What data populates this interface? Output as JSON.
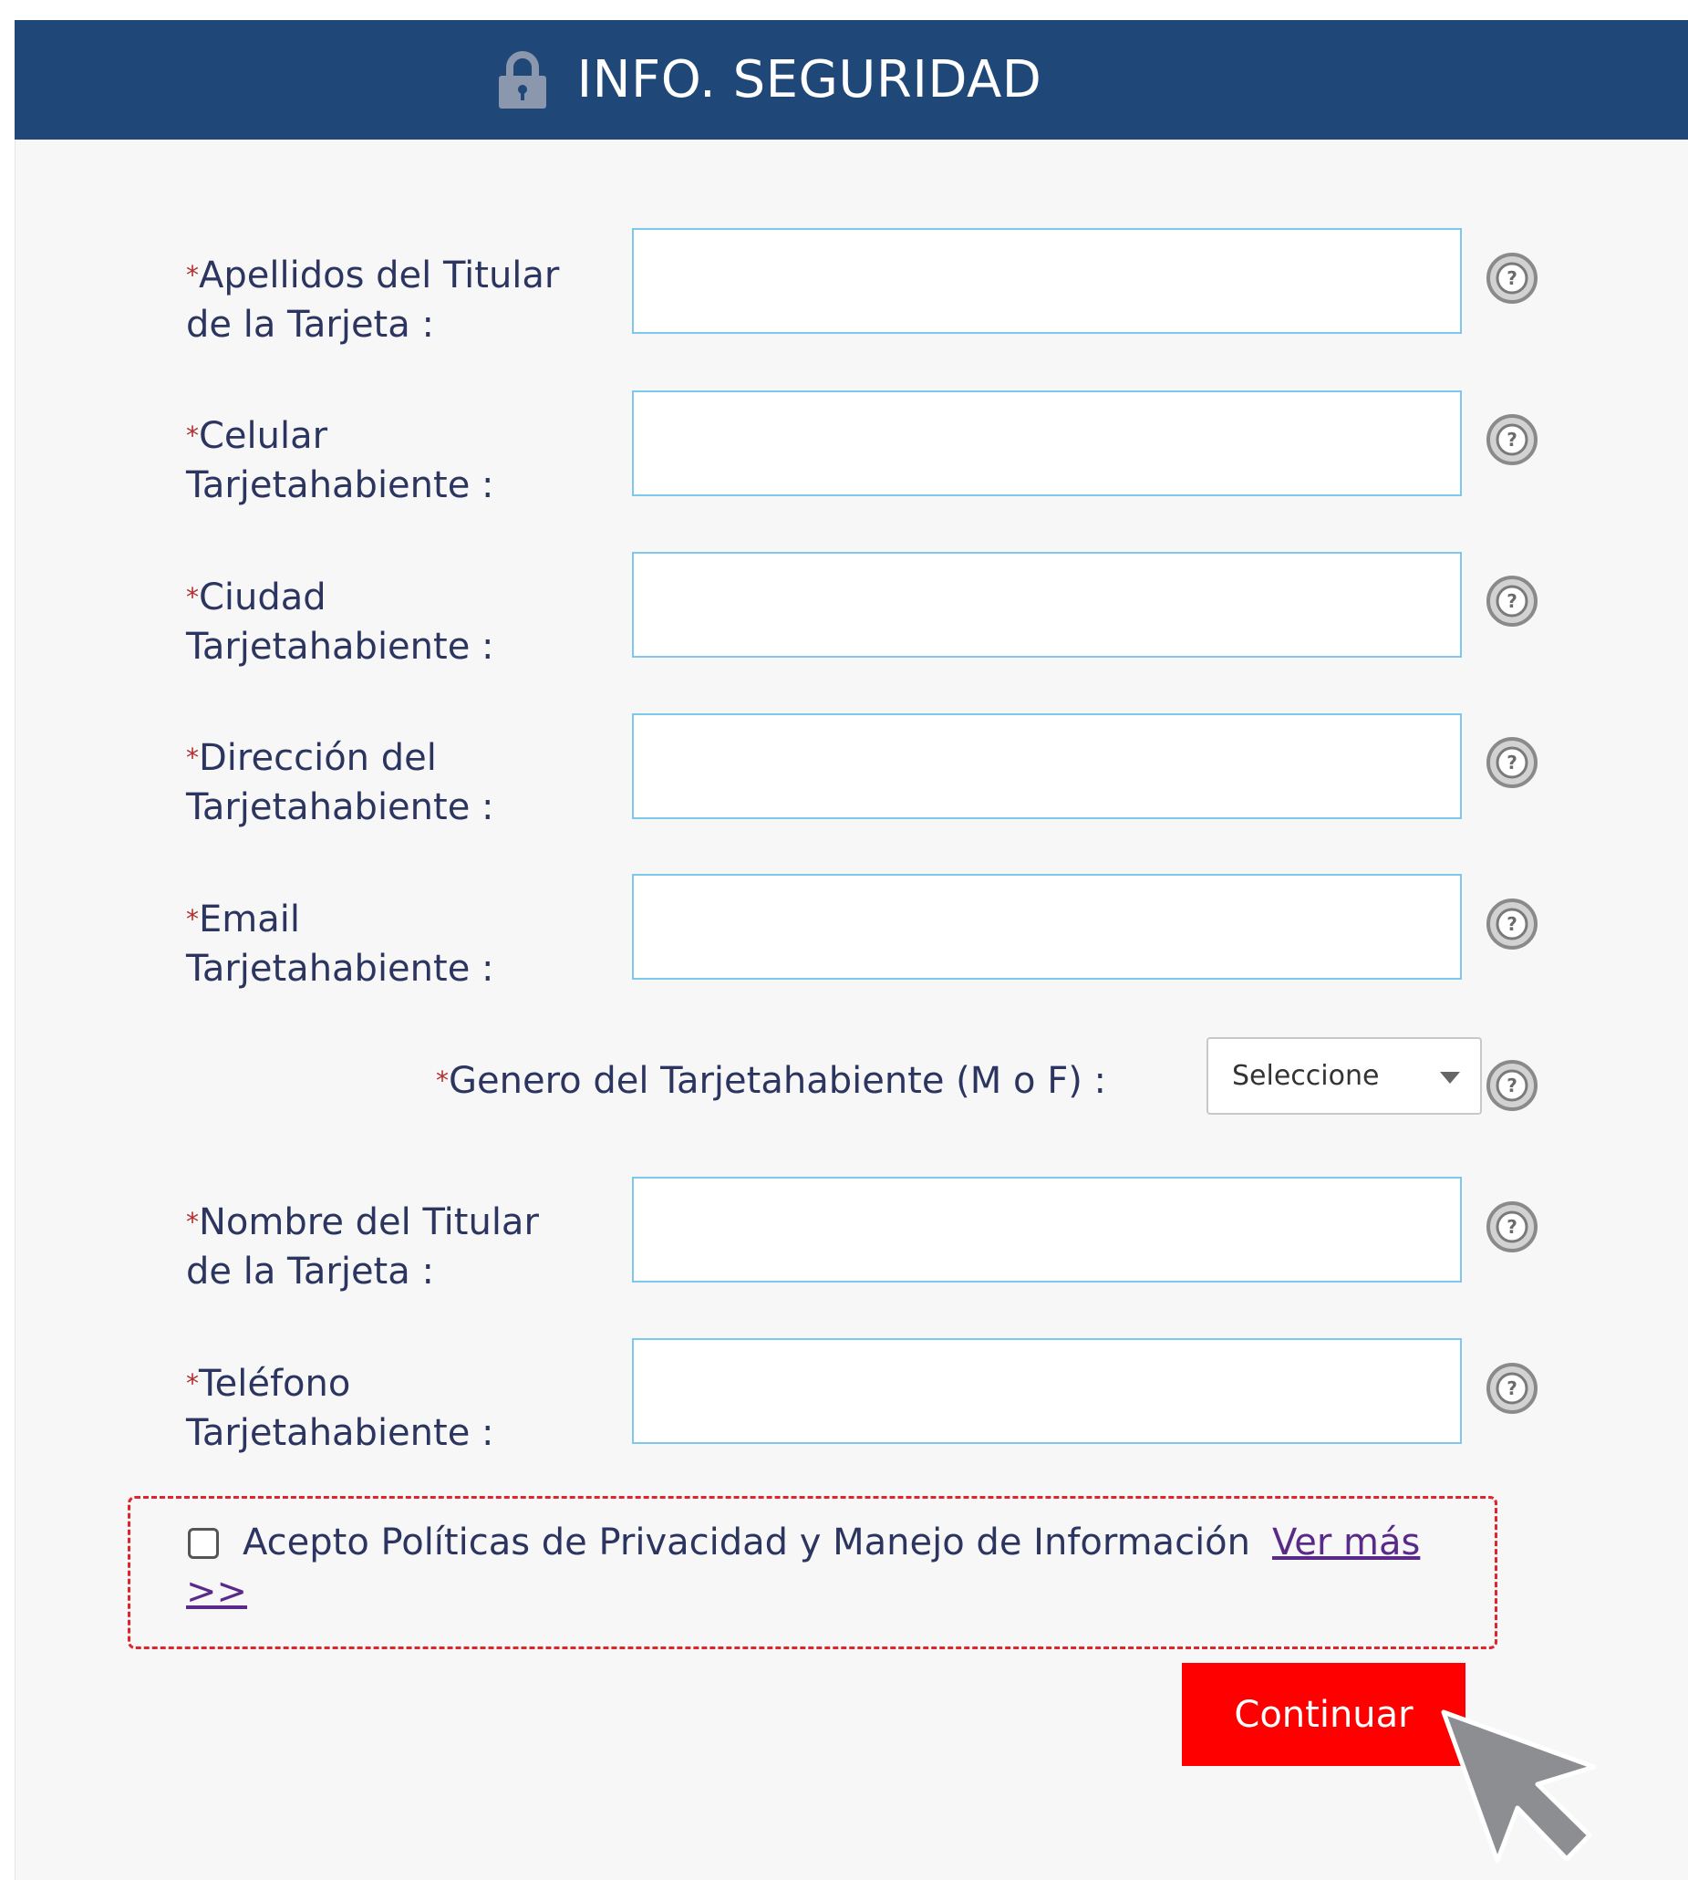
{
  "header": {
    "title": "INFO. SEGURIDAD",
    "icon": "lock-icon"
  },
  "form": {
    "required_marker": "*",
    "fields": [
      {
        "label_line1": "Apellidos del Titular",
        "label_line2": "de la Tarjeta :",
        "value": ""
      },
      {
        "label_line1": "Celular",
        "label_line2": "Tarjetahabiente :",
        "value": ""
      },
      {
        "label_line1": "Ciudad",
        "label_line2": "Tarjetahabiente :",
        "value": ""
      },
      {
        "label_line1": "Dirección del",
        "label_line2": "Tarjetahabiente :",
        "value": ""
      },
      {
        "label_line1": "Email",
        "label_line2": "Tarjetahabiente :",
        "value": ""
      },
      {
        "label_line1": "Nombre del Titular",
        "label_line2": "de la Tarjeta :",
        "value": ""
      },
      {
        "label_line1": "Teléfono",
        "label_line2": "Tarjetahabiente :",
        "value": ""
      }
    ],
    "gender": {
      "label": "Genero del Tarjetahabiente (M o F) :",
      "selected": "Seleccione"
    },
    "help_icon": "help-question-icon"
  },
  "consent": {
    "checked": false,
    "text": "Acepto Políticas de Privacidad y Manejo de Información",
    "link_text": "Ver más >>"
  },
  "actions": {
    "continue_label": "Continuar"
  },
  "colors": {
    "header_bg": "#1f4778",
    "button_bg": "#ff0000",
    "field_border": "#7ec8ee",
    "consent_border": "#e0242c"
  }
}
